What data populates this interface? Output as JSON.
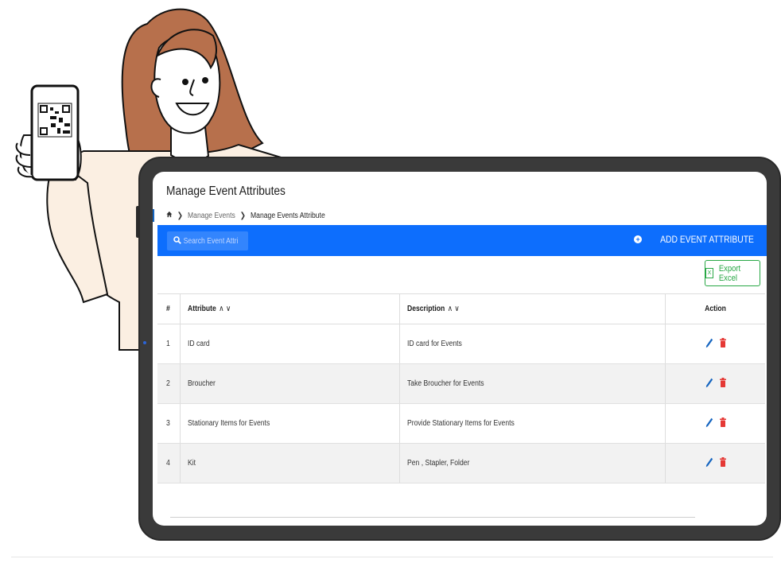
{
  "page": {
    "title": "Manage Event Attributes",
    "breadcrumb": {
      "home_icon": "home-icon",
      "items": [
        "Manage Events",
        "Manage Events Attribute"
      ]
    }
  },
  "toolbar": {
    "search_placeholder": "Search Event Attribute",
    "add_label": "ADD EVENT ATTRIBUTE",
    "color": "#0d6efd"
  },
  "export": {
    "label": "Export Excel",
    "color": "#28a745"
  },
  "table": {
    "headers": {
      "num": "#",
      "attribute": "Attribute",
      "description": "Description",
      "action": "Action"
    },
    "rows": [
      {
        "num": "1",
        "attribute": "ID card",
        "description": "ID card for Events"
      },
      {
        "num": "2",
        "attribute": "Broucher",
        "description": "Take Broucher for Events"
      },
      {
        "num": "3",
        "attribute": "Stationary Items for Events",
        "description": "Provide Stationary Items for Events"
      },
      {
        "num": "4",
        "attribute": "Kit",
        "description": "Pen , Stapler, Folder"
      }
    ]
  },
  "icons": {
    "edit": "pencil-icon",
    "delete": "trash-icon",
    "edit_color": "#1565c0",
    "delete_color": "#e53935"
  }
}
